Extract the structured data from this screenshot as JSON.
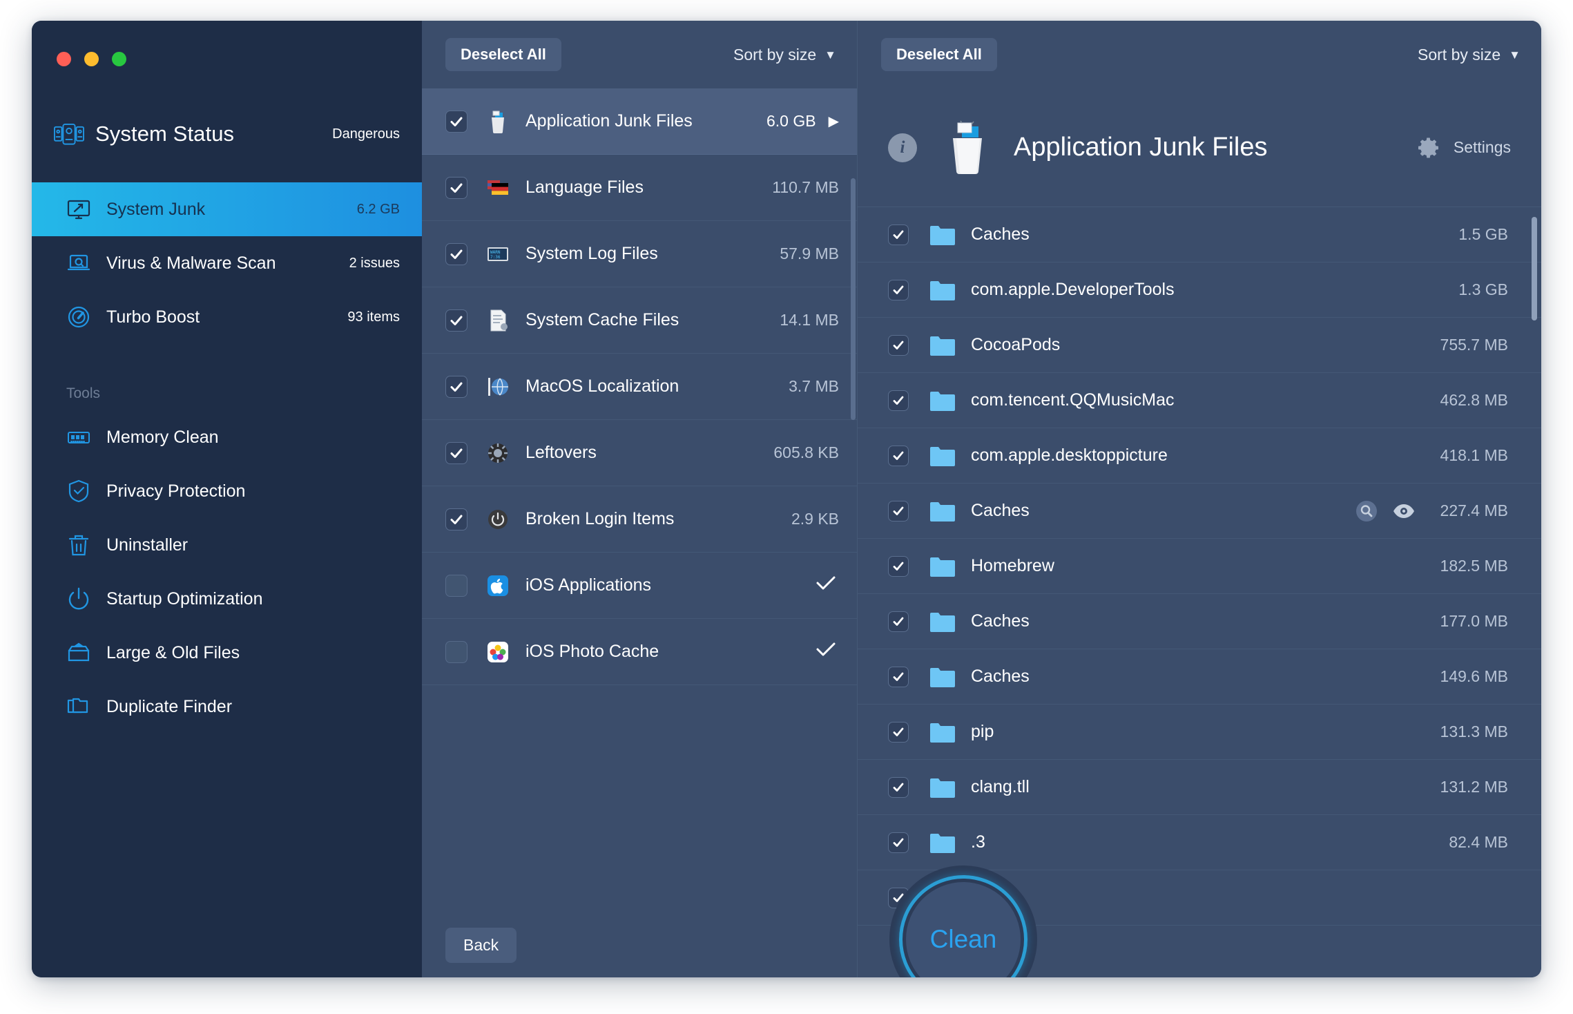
{
  "window": {
    "traffic_lights": [
      "close",
      "minimize",
      "maximize"
    ]
  },
  "sidebar": {
    "status": {
      "title": "System Status",
      "value": "Dangerous",
      "icon": "system-status-icon"
    },
    "nav": [
      {
        "label": "System Junk",
        "meta": "6.2 GB",
        "icon": "monitor-icon",
        "active": true
      },
      {
        "label": "Virus & Malware Scan",
        "meta": "2 issues",
        "icon": "laptop-search-icon",
        "active": false
      },
      {
        "label": "Turbo Boost",
        "meta": "93 items",
        "icon": "speedometer-icon",
        "active": false
      }
    ],
    "tools_header": "Tools",
    "tools": [
      {
        "label": "Memory Clean",
        "icon": "ram-icon"
      },
      {
        "label": "Privacy Protection",
        "icon": "shield-check-icon"
      },
      {
        "label": "Uninstaller",
        "icon": "trash-icon"
      },
      {
        "label": "Startup Optimization",
        "icon": "power-icon"
      },
      {
        "label": "Large & Old Files",
        "icon": "box-icon"
      },
      {
        "label": "Duplicate Finder",
        "icon": "duplicate-folder-icon"
      }
    ]
  },
  "middle": {
    "deselect_label": "Deselect All",
    "sort_label": "Sort by size",
    "back_label": "Back",
    "rows": [
      {
        "label": "Application Junk Files",
        "size": "6.0 GB",
        "checked": true,
        "selected": true,
        "arrow": true,
        "icon": "trash-full-icon"
      },
      {
        "label": "Language Files",
        "size": "110.7 MB",
        "checked": true,
        "selected": false,
        "arrow": false,
        "icon": "flags-icon"
      },
      {
        "label": "System Log Files",
        "size": "57.9 MB",
        "checked": true,
        "selected": false,
        "arrow": false,
        "icon": "log-screen-icon"
      },
      {
        "label": "System Cache Files",
        "size": "14.1 MB",
        "checked": true,
        "selected": false,
        "arrow": false,
        "icon": "document-gear-icon"
      },
      {
        "label": "MacOS Localization",
        "size": "3.7 MB",
        "checked": true,
        "selected": false,
        "arrow": false,
        "icon": "globe-icon"
      },
      {
        "label": "Leftovers",
        "size": "605.8 KB",
        "checked": true,
        "selected": false,
        "arrow": false,
        "icon": "gear-dark-icon"
      },
      {
        "label": "Broken Login Items",
        "size": "2.9 KB",
        "checked": true,
        "selected": false,
        "arrow": false,
        "icon": "power-circle-icon"
      },
      {
        "label": "iOS Applications",
        "size": "",
        "checked": false,
        "selected": false,
        "arrow": false,
        "icon": "ios-apps-icon",
        "done": true
      },
      {
        "label": "iOS Photo Cache",
        "size": "",
        "checked": false,
        "selected": false,
        "arrow": false,
        "icon": "ios-photo-icon",
        "done": true
      }
    ]
  },
  "detail": {
    "deselect_label": "Deselect All",
    "sort_label": "Sort by size",
    "title": "Application Junk Files",
    "settings_label": "Settings",
    "info_glyph": "i",
    "clean_label": "Clean",
    "rows": [
      {
        "name": "Caches",
        "size": "1.5 GB",
        "checked": true,
        "actions": false
      },
      {
        "name": "com.apple.DeveloperTools",
        "size": "1.3 GB",
        "checked": true,
        "actions": false
      },
      {
        "name": "CocoaPods",
        "size": "755.7 MB",
        "checked": true,
        "actions": false
      },
      {
        "name": "com.tencent.QQMusicMac",
        "size": "462.8 MB",
        "checked": true,
        "actions": false
      },
      {
        "name": "com.apple.desktoppicture",
        "size": "418.1 MB",
        "checked": true,
        "actions": false
      },
      {
        "name": "Caches",
        "size": "227.4 MB",
        "checked": true,
        "actions": true
      },
      {
        "name": "Homebrew",
        "size": "182.5 MB",
        "checked": true,
        "actions": false
      },
      {
        "name": "Caches",
        "size": "177.0 MB",
        "checked": true,
        "actions": false
      },
      {
        "name": "Caches",
        "size": "149.6 MB",
        "checked": true,
        "actions": false
      },
      {
        "name": "pip",
        "size": "131.3 MB",
        "checked": true,
        "actions": false
      },
      {
        "name": "clang.tll",
        "size": "131.2 MB",
        "checked": true,
        "actions": false
      },
      {
        "name": ".3",
        "size": "82.4 MB",
        "checked": true,
        "actions": false
      },
      {
        "name": "",
        "size": "",
        "checked": true,
        "actions": false
      }
    ]
  },
  "colors": {
    "sidebar_bg": "#1e2d47",
    "panel_bg": "#3b4d6b",
    "accent_blue": "#2aa3f0",
    "active_gradient_from": "#24b8e8",
    "active_gradient_to": "#1e8fe0",
    "icon_blue": "#2196e3"
  }
}
